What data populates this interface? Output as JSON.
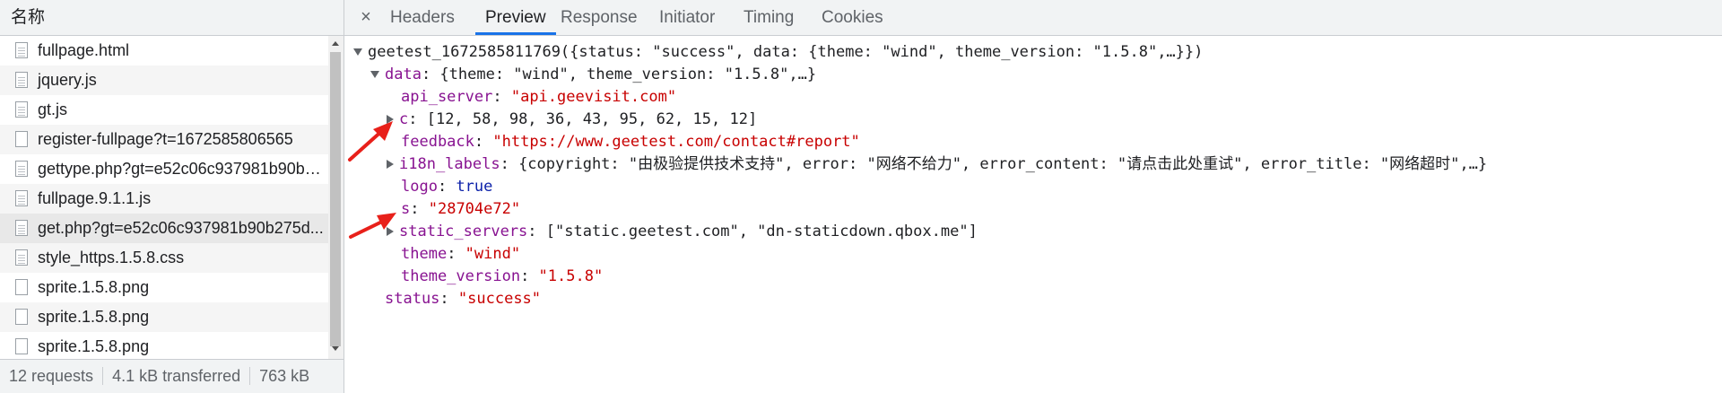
{
  "colors": {
    "accent": "#1a73e8",
    "arrow": "#e8201a",
    "key": "#881391",
    "string": "#c80000",
    "keyword": "#0d22aa"
  },
  "list": {
    "header": "名称",
    "items": [
      {
        "name": "fullpage.html",
        "icon": "doc-file-icon"
      },
      {
        "name": "jquery.js",
        "icon": "doc-file-icon"
      },
      {
        "name": "gt.js",
        "icon": "doc-file-icon"
      },
      {
        "name": "register-fullpage?t=1672585806565",
        "icon": "blank-file-icon"
      },
      {
        "name": "gettype.php?gt=e52c06c937981b90b2...",
        "icon": "doc-file-icon"
      },
      {
        "name": "fullpage.9.1.1.js",
        "icon": "doc-file-icon"
      },
      {
        "name": "get.php?gt=e52c06c937981b90b275d...",
        "icon": "doc-file-icon"
      },
      {
        "name": "style_https.1.5.8.css",
        "icon": "doc-file-icon"
      },
      {
        "name": "sprite.1.5.8.png",
        "icon": "blank-file-icon"
      },
      {
        "name": "sprite.1.5.8.png",
        "icon": "blank-file-icon"
      },
      {
        "name": "sprite.1.5.8.png",
        "icon": "blank-file-icon"
      }
    ],
    "status": {
      "requests": "12 requests",
      "transferred": "4.1 kB transferred",
      "size": "763 kB"
    }
  },
  "tabs": {
    "close": "×",
    "items": [
      "Headers",
      "Preview",
      "Response",
      "Initiator",
      "Timing",
      "Cookies"
    ],
    "active": "Preview"
  },
  "preview": {
    "root": "geetest_1672585811769({status: \"success\", data: {theme: \"wind\", theme_version: \"1.5.8\",…}})",
    "data_key": "data",
    "data_summary": ": {theme: \"wind\", theme_version: \"1.5.8\",…}",
    "api_server_key": "api_server",
    "api_server_val": "\"api.geevisit.com\"",
    "c_key": "c",
    "c_val": ": [12, 58, 98, 36, 43, 95, 62, 15, 12]",
    "feedback_key": "feedback",
    "feedback_val": "\"https://www.geetest.com/contact#report\"",
    "i18n_key": "i18n_labels",
    "i18n_val": ": {copyright: \"由极验提供技术支持\", error: \"网络不给力\", error_content: \"请点击此处重试\", error_title: \"网络超时\",…}",
    "logo_key": "logo",
    "logo_val": "true",
    "s_key": "s",
    "s_val": "\"28704e72\"",
    "static_key": "static_servers",
    "static_val": ": [\"static.geetest.com\", \"dn-staticdown.qbox.me\"]",
    "theme_key": "theme",
    "theme_val": "\"wind\"",
    "theme_version_key": "theme_version",
    "theme_version_val": "\"1.5.8\"",
    "status_key": "status",
    "status_val": "\"success\""
  }
}
